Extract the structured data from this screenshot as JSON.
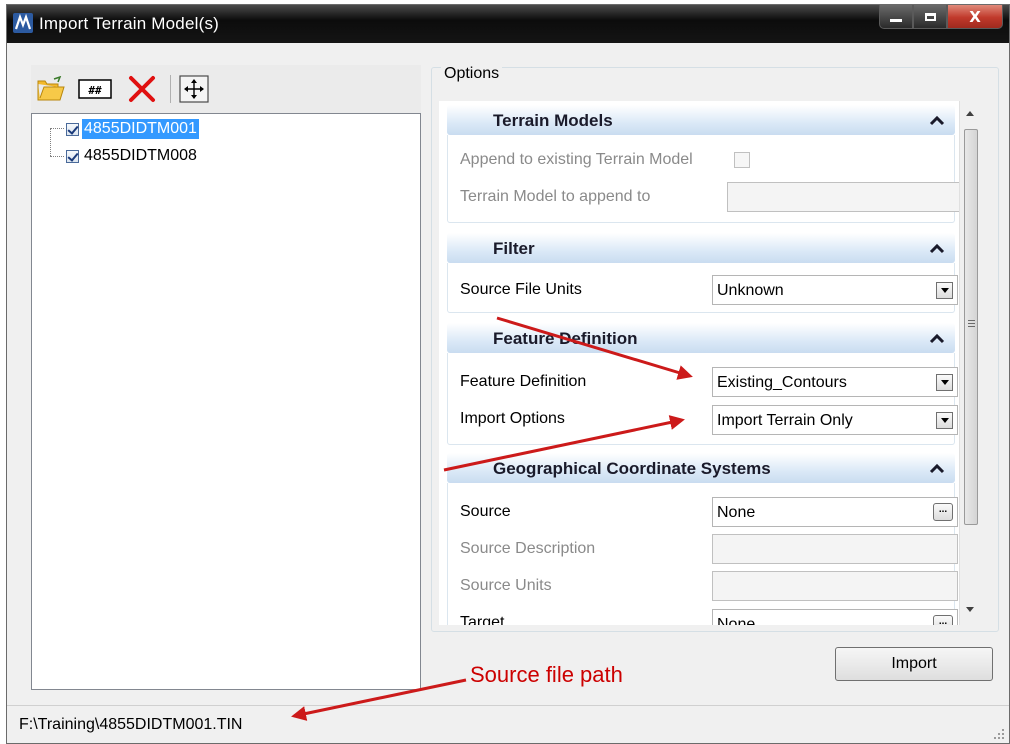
{
  "window": {
    "title": "Import Terrain Model(s)",
    "close_glyph": "X"
  },
  "toolbar": {
    "icons": [
      "open-folder-icon",
      "grid-hash-icon",
      "delete-x-icon",
      "fit-view-icon"
    ]
  },
  "tree": {
    "items": [
      {
        "label": "4855DIDTM001",
        "checked": true,
        "selected": true
      },
      {
        "label": "4855DIDTM008",
        "checked": true,
        "selected": false
      }
    ]
  },
  "options": {
    "group_label": "Options",
    "sections": {
      "terrain_models": {
        "title": "Terrain Models",
        "append_label": "Append to existing Terrain Model",
        "append_to_label": "Terrain Model to append to"
      },
      "filter": {
        "title": "Filter",
        "units_label": "Source File Units",
        "units_value": "Unknown"
      },
      "feature_definition": {
        "title": "Feature Definition",
        "feature_label": "Feature Definition",
        "feature_value": "Existing_Contours",
        "import_label": "Import Options",
        "import_value": "Import Terrain Only"
      },
      "gcs": {
        "title": "Geographical Coordinate Systems",
        "source_label": "Source",
        "source_value": "None",
        "source_desc_label": "Source Description",
        "source_units_label": "Source Units",
        "target_label": "Target",
        "target_value": "None"
      }
    }
  },
  "buttons": {
    "import_label": "Import",
    "ellipsis": "..."
  },
  "status": {
    "path": "F:\\Training\\4855DIDTM001.TIN"
  },
  "annotation": {
    "text": "Source file path",
    "color": "#cc0000"
  }
}
